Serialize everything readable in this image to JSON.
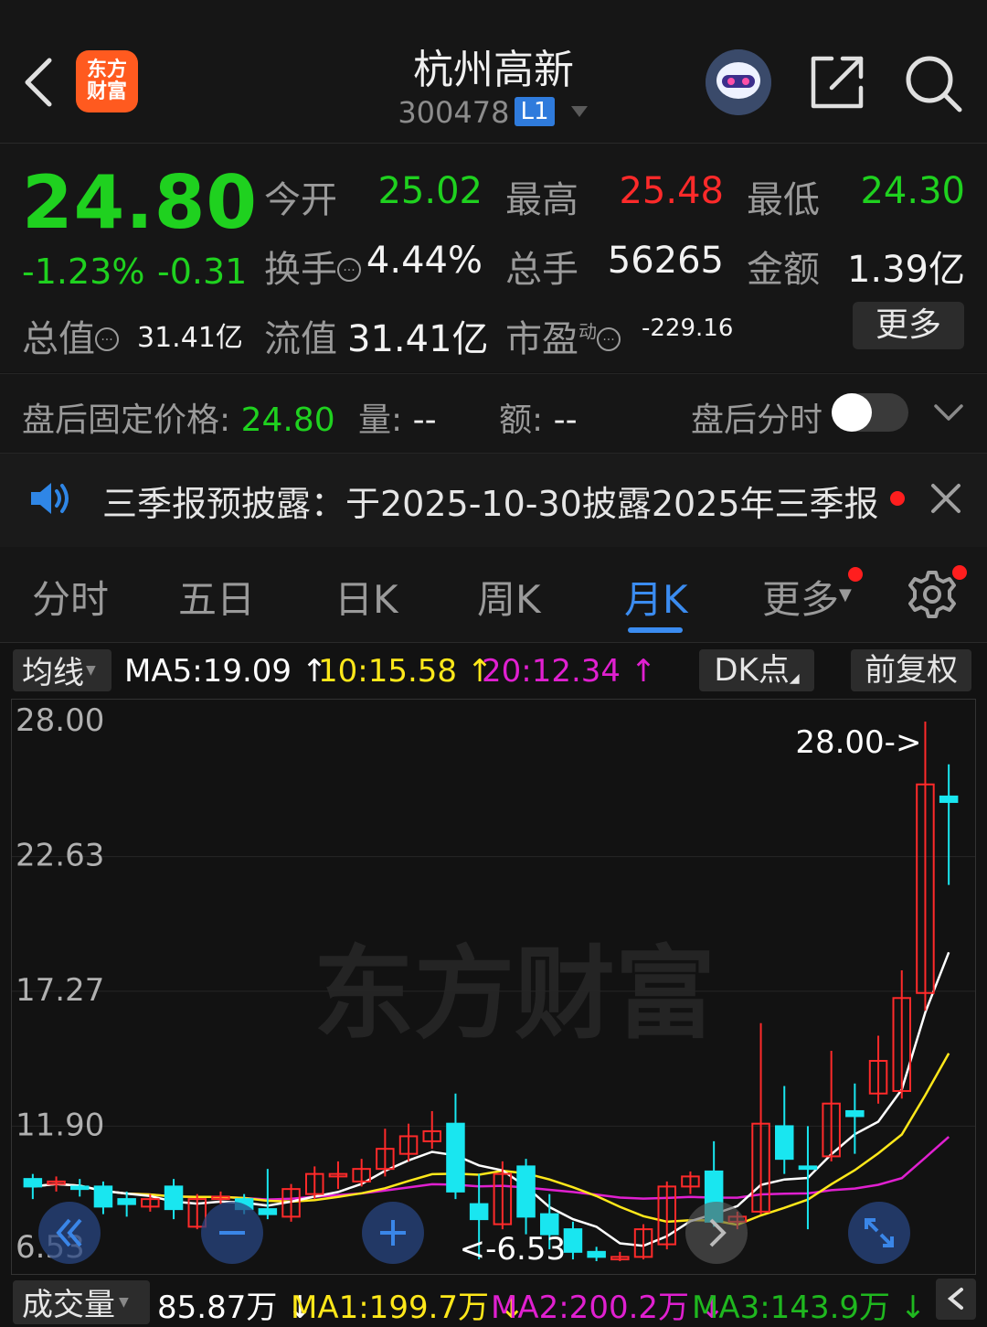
{
  "header": {
    "title": "杭州高新",
    "code": "300478",
    "level_badge": "L1",
    "logo_line1": "东方",
    "logo_line2": "财富",
    "icons": [
      "back-icon",
      "robot-avatar-icon",
      "share-icon",
      "search-icon",
      "chevron-down-icon"
    ]
  },
  "quote": {
    "price": "24.80",
    "change_pct": "-1.23%",
    "change_val": "-0.31",
    "open_label": "今开",
    "open_value": "25.02",
    "high_label": "最高",
    "high_value": "25.48",
    "low_label": "最低",
    "low_value": "24.30",
    "turnover_label": "换手",
    "turnover_value": "4.44%",
    "volume_label": "总手",
    "volume_value": "56265",
    "amount_label": "金额",
    "amount_value": "1.39亿",
    "mktcap_label": "总值",
    "mktcap_value": "31.41亿",
    "float_label": "流值",
    "float_value": "31.41亿",
    "pe_label": "市盈",
    "pe_super": "动",
    "pe_value": "-229.16",
    "more_label": "更多",
    "colors": {
      "down": "#1fd11f",
      "up": "#ff2a2a"
    }
  },
  "afterhours": {
    "fixed_price_label": "盘后固定价格:",
    "fixed_price_value": "24.80",
    "vol_label": "量:",
    "vol_value": "--",
    "amt_label": "额:",
    "amt_value": "--",
    "timeshare_label": "盘后分时"
  },
  "notice": {
    "text": "三季报预披露：于2025-10-30披露2025年三季报"
  },
  "tabs": [
    {
      "label": "分时"
    },
    {
      "label": "五日"
    },
    {
      "label": "日K"
    },
    {
      "label": "周K"
    },
    {
      "label": "月K",
      "active": true
    },
    {
      "label": "更多"
    }
  ],
  "ma_bar": {
    "selector": "均线",
    "ma5": "MA5:19.09",
    "ma10": "10:15.58",
    "ma20": "20:12.34",
    "dk": "DK点",
    "adjust": "前复权",
    "colors": {
      "ma5": "#ffffff",
      "ma10": "#ffe81a",
      "ma20": "#e020d0"
    }
  },
  "chart_data": {
    "type": "candlestick",
    "y_ticks": [
      "28.00",
      "22.63",
      "17.27",
      "11.90",
      "6.53"
    ],
    "ylim": [
      6.53,
      28.0
    ],
    "max_marker": "28.00->",
    "min_marker": "<-6.53",
    "watermark": "东方财富",
    "candles": [
      {
        "o": 9.8,
        "c": 9.5,
        "h": 10.0,
        "l": 9.0
      },
      {
        "o": 9.6,
        "c": 9.7,
        "h": 9.9,
        "l": 9.3
      },
      {
        "o": 9.5,
        "c": 9.4,
        "h": 9.8,
        "l": 9.1
      },
      {
        "o": 9.5,
        "c": 8.7,
        "h": 9.7,
        "l": 8.4
      },
      {
        "o": 9.0,
        "c": 8.8,
        "h": 9.3,
        "l": 8.3
      },
      {
        "o": 8.7,
        "c": 9.0,
        "h": 9.2,
        "l": 8.5
      },
      {
        "o": 9.5,
        "c": 8.6,
        "h": 9.8,
        "l": 8.2
      },
      {
        "o": 7.9,
        "c": 9.0,
        "h": 9.2,
        "l": 7.8
      },
      {
        "o": 9.0,
        "c": 9.1,
        "h": 9.3,
        "l": 8.8
      },
      {
        "o": 9.0,
        "c": 8.6,
        "h": 9.2,
        "l": 8.4
      },
      {
        "o": 8.6,
        "c": 8.4,
        "h": 10.2,
        "l": 8.2
      },
      {
        "o": 8.3,
        "c": 9.4,
        "h": 9.6,
        "l": 8.1
      },
      {
        "o": 9.2,
        "c": 10.0,
        "h": 10.3,
        "l": 9.0
      },
      {
        "o": 9.9,
        "c": 10.0,
        "h": 10.5,
        "l": 9.4
      },
      {
        "o": 9.7,
        "c": 10.2,
        "h": 10.6,
        "l": 9.5
      },
      {
        "o": 10.2,
        "c": 11.0,
        "h": 11.8,
        "l": 9.9
      },
      {
        "o": 10.8,
        "c": 11.5,
        "h": 12.0,
        "l": 10.5
      },
      {
        "o": 11.3,
        "c": 11.7,
        "h": 12.5,
        "l": 11.0
      },
      {
        "o": 12.0,
        "c": 9.3,
        "h": 13.2,
        "l": 9.0
      },
      {
        "o": 8.8,
        "c": 8.2,
        "h": 10.0,
        "l": 6.6
      },
      {
        "o": 8.0,
        "c": 10.0,
        "h": 10.5,
        "l": 7.8
      },
      {
        "o": 10.3,
        "c": 8.3,
        "h": 10.6,
        "l": 7.6
      },
      {
        "o": 8.4,
        "c": 7.6,
        "h": 9.2,
        "l": 7.0
      },
      {
        "o": 7.8,
        "c": 6.9,
        "h": 8.1,
        "l": 6.6
      },
      {
        "o": 6.9,
        "c": 6.7,
        "h": 7.1,
        "l": 6.53
      },
      {
        "o": 6.6,
        "c": 6.7,
        "h": 6.9,
        "l": 6.53
      },
      {
        "o": 6.7,
        "c": 7.8,
        "h": 8.0,
        "l": 6.6
      },
      {
        "o": 7.2,
        "c": 9.5,
        "h": 9.7,
        "l": 7.0
      },
      {
        "o": 9.5,
        "c": 9.9,
        "h": 10.1,
        "l": 9.2
      },
      {
        "o": 10.1,
        "c": 8.1,
        "h": 11.3,
        "l": 7.9
      },
      {
        "o": 8.1,
        "c": 8.3,
        "h": 8.5,
        "l": 7.8
      },
      {
        "o": 8.5,
        "c": 12.0,
        "h": 16.0,
        "l": 8.4
      },
      {
        "o": 11.9,
        "c": 10.6,
        "h": 13.5,
        "l": 10.0
      },
      {
        "o": 10.3,
        "c": 10.2,
        "h": 11.9,
        "l": 7.8
      },
      {
        "o": 10.7,
        "c": 12.8,
        "h": 14.9,
        "l": 10.5
      },
      {
        "o": 12.5,
        "c": 12.3,
        "h": 13.6,
        "l": 10.8
      },
      {
        "o": 13.2,
        "c": 14.5,
        "h": 15.5,
        "l": 12.8
      },
      {
        "o": 13.3,
        "c": 17.0,
        "h": 18.1,
        "l": 13.0
      },
      {
        "o": 17.2,
        "c": 25.5,
        "h": 28.0,
        "l": 16.5
      },
      {
        "o": 25.02,
        "c": 24.8,
        "h": 26.3,
        "l": 21.5
      }
    ]
  },
  "volume_bar": {
    "selector": "成交量",
    "vol": "85.87万",
    "ma1": "MA1:199.7万",
    "ma2": "MA2:200.2万",
    "ma3": "MA3:143.9万"
  }
}
